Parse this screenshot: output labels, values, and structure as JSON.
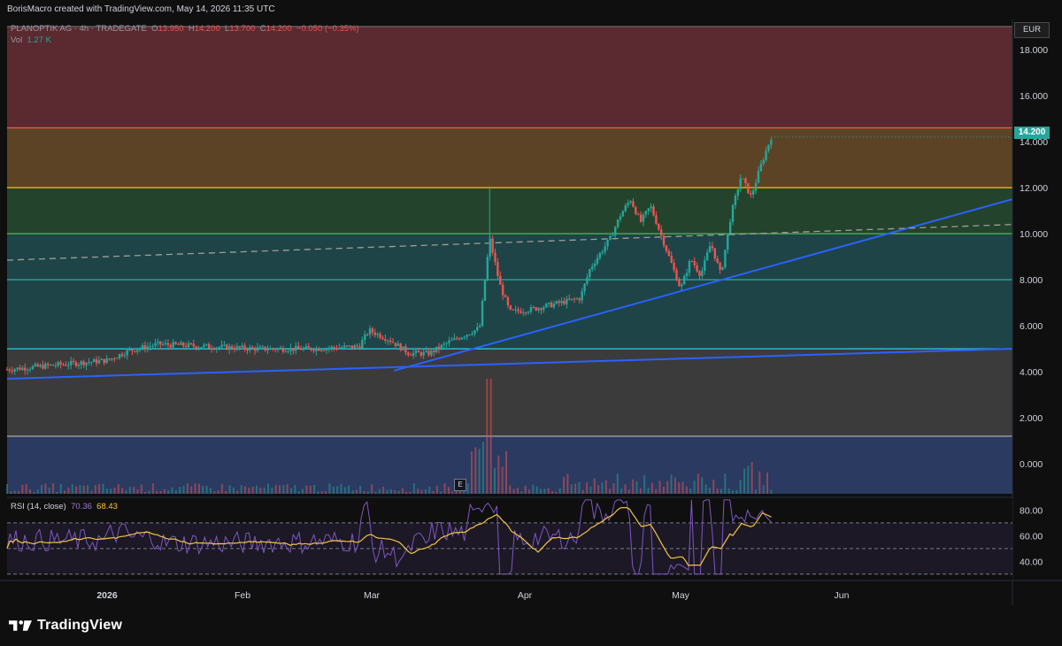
{
  "header": {
    "credit": "BorisMacro created with TradingView.com, May 14, 2026 11:35 UTC"
  },
  "legend": {
    "symbol": "PLANOPTIK AG · 4h · TRADEGATE",
    "o_label": "O",
    "o_value": "13.950",
    "h_label": "H",
    "h_value": "14.200",
    "l_label": "L",
    "l_value": "13.700",
    "c_label": "C",
    "c_value": "14.200",
    "change": "−0.050 (−0.35%)",
    "vol_label": "Vol",
    "vol_value": "1.27 K",
    "rsi_label": "RSI (14, close)",
    "rsi_value": "70.36",
    "rsi_ma_value": "68.43"
  },
  "currency": "EUR",
  "last_price": "14.200",
  "earnings_badge": "E",
  "footer": {
    "brand": "TradingView"
  },
  "colors": {
    "up": "#26a69a",
    "down": "#ef5350",
    "trendline": "#2962ff",
    "rsi_line": "#7e57c2",
    "rsi_ma": "#f5c542",
    "zone_red": "#5a2a30",
    "zone_orange": "#5c4325",
    "zone_green": "#24432c",
    "zone_teal": "#1e4447",
    "zone_gray": "#3b3b3b",
    "zone_blue": "#2b3a61"
  },
  "chart_data": [
    {
      "type": "candlestick",
      "title": "",
      "x_ticks": [
        "2026",
        "Feb",
        "Mar",
        "Apr",
        "May",
        "Jun"
      ],
      "y_ticks": [
        "18.000",
        "16.000",
        "14.000",
        "12.000",
        "10.000",
        "8.000",
        "6.000",
        "4.000",
        "2.000",
        "0.000"
      ],
      "ylim": [
        -1.3,
        19.0
      ],
      "horizontal_levels": [
        {
          "price": 14.6,
          "color": "#ef5350"
        },
        {
          "price": 12.0,
          "color": "#f5b800"
        },
        {
          "price": 10.0,
          "color": "#4caf50"
        },
        {
          "price": 8.0,
          "color": "#26a69a"
        },
        {
          "price": 5.0,
          "color": "#26c6da"
        },
        {
          "price": 1.2,
          "color": "#9e9e9e"
        }
      ],
      "zones": [
        {
          "from": 14.6,
          "to": 19.0,
          "color": "zone_red"
        },
        {
          "from": 12.0,
          "to": 14.6,
          "color": "zone_orange"
        },
        {
          "from": 10.0,
          "to": 12.0,
          "color": "zone_green"
        },
        {
          "from": 5.0,
          "to": 10.0,
          "color": "zone_teal"
        },
        {
          "from": 1.2,
          "to": 5.0,
          "color": "zone_gray"
        },
        {
          "from": -1.3,
          "to": 1.2,
          "color": "zone_blue"
        }
      ],
      "price_path": [
        [
          0,
          4.1
        ],
        [
          0.05,
          4.3
        ],
        [
          0.1,
          4.5
        ],
        [
          0.12,
          4.9
        ],
        [
          0.15,
          5.2
        ],
        [
          0.2,
          5.1
        ],
        [
          0.25,
          5.0
        ],
        [
          0.3,
          5.0
        ],
        [
          0.35,
          5.1
        ],
        [
          0.36,
          5.8
        ],
        [
          0.38,
          5.4
        ],
        [
          0.4,
          4.8
        ],
        [
          0.42,
          4.8
        ],
        [
          0.44,
          5.3
        ],
        [
          0.47,
          5.9
        ],
        [
          0.48,
          9.8
        ],
        [
          0.49,
          7.8
        ],
        [
          0.5,
          6.6
        ],
        [
          0.52,
          6.7
        ],
        [
          0.55,
          7.0
        ],
        [
          0.57,
          7.2
        ],
        [
          0.58,
          8.5
        ],
        [
          0.6,
          9.8
        ],
        [
          0.61,
          10.8
        ],
        [
          0.62,
          11.5
        ],
        [
          0.63,
          10.5
        ],
        [
          0.64,
          11.2
        ],
        [
          0.65,
          10.0
        ],
        [
          0.66,
          8.8
        ],
        [
          0.67,
          7.6
        ],
        [
          0.68,
          8.9
        ],
        [
          0.69,
          8.2
        ],
        [
          0.7,
          9.6
        ],
        [
          0.71,
          8.2
        ],
        [
          0.72,
          10.8
        ],
        [
          0.73,
          12.5
        ],
        [
          0.74,
          11.6
        ],
        [
          0.75,
          13.0
        ],
        [
          0.76,
          14.2
        ]
      ],
      "volume_spike_index": 0.48,
      "rsi": {
        "ylim": [
          25,
          90
        ],
        "y_ticks": [
          "80.00",
          "60.00",
          "40.00"
        ],
        "bands": [
          70,
          50,
          30
        ],
        "rsi_value": 70.36,
        "ma_value": 68.43
      }
    }
  ]
}
